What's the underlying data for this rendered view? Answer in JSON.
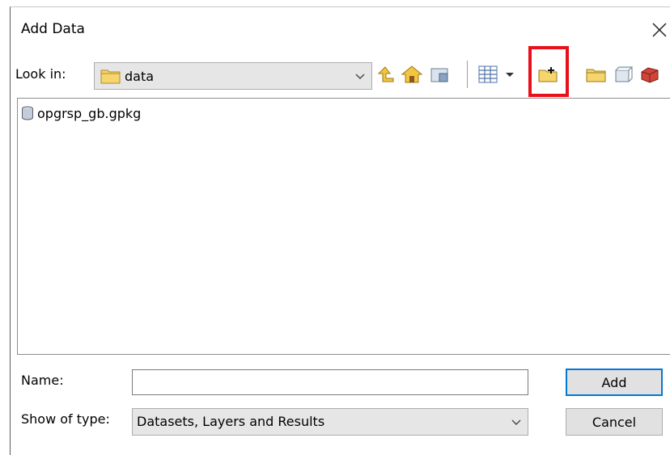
{
  "window": {
    "title": "Add Data"
  },
  "lookin": {
    "label": "Look in:",
    "value": "data"
  },
  "toolbar": {
    "buttons": [
      "up-one-level-icon",
      "home-icon",
      "connect-folder-icon",
      "view-list-icon",
      "view-dropdown-icon",
      "connect-to-folder-icon",
      "new-folder-icon",
      "new-file-geodatabase-icon",
      "new-toolbox-icon"
    ],
    "highlight_color": "#e8101a"
  },
  "files": [
    {
      "name": "opgrsp_gb.gpkg",
      "icon": "database-icon"
    }
  ],
  "name_field": {
    "label": "Name:",
    "value": "",
    "placeholder": ""
  },
  "type_field": {
    "label": "Show of type:",
    "value": "Datasets, Layers and Results"
  },
  "buttons": {
    "add": "Add",
    "cancel": "Cancel"
  },
  "colors": {
    "accent": "#0078d7",
    "folder": "#f3cc5c"
  }
}
